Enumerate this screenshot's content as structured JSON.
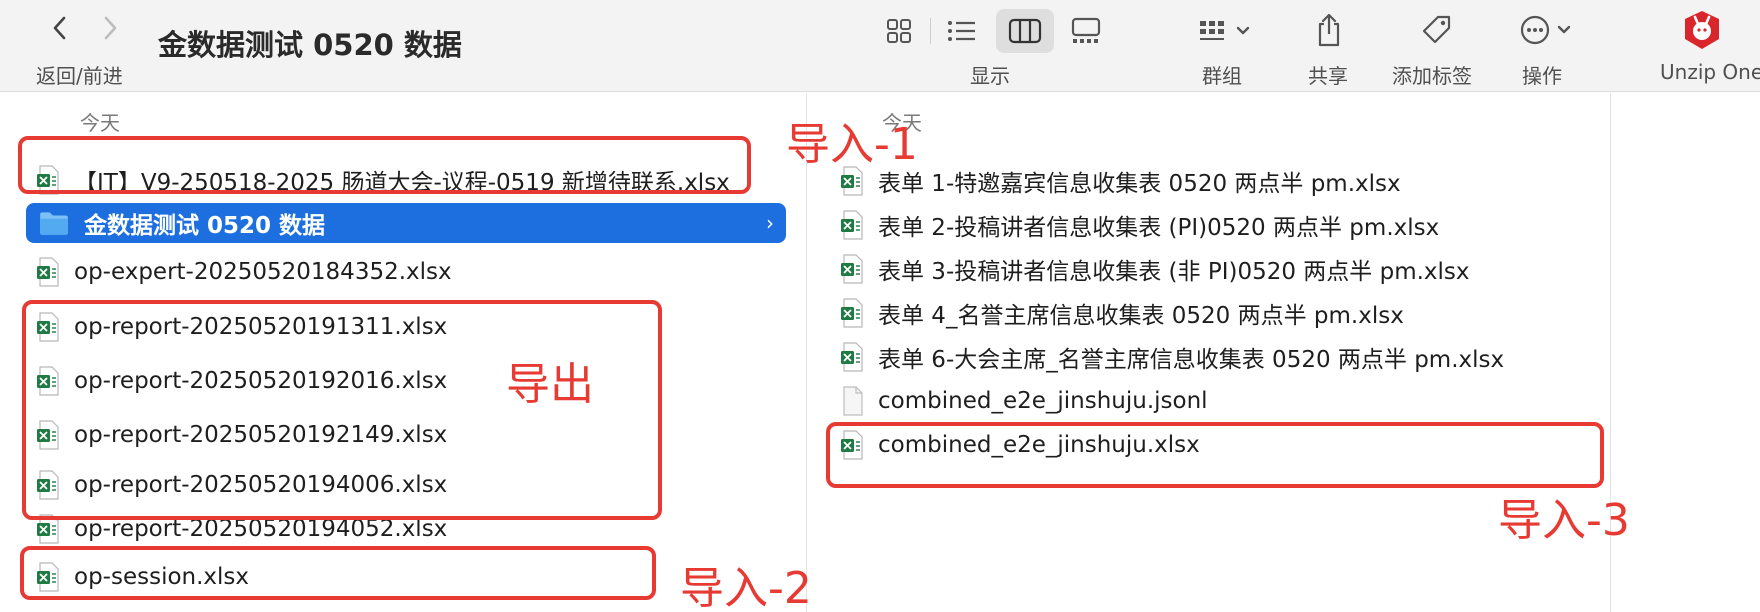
{
  "toolbar": {
    "title": "金数据测试 0520 数据",
    "nav_caption": "返回/前进",
    "back_icon": "chevron-left-icon",
    "forward_icon": "chevron-right-icon",
    "view_label": "显示",
    "group_label": "群组",
    "share_label": "共享",
    "tag_label": "添加标签",
    "action_label": "操作",
    "extension_label": "Unzip One"
  },
  "columns": {
    "left_section": "今天",
    "right_section": "今天"
  },
  "left_items": [
    {
      "name": "【IT】V9-250518-2025 肠道大会-议程-0519 新增待联系.xlsx",
      "kind": "xlsx"
    },
    {
      "name": "金数据测试 0520 数据",
      "kind": "folder",
      "selected": true
    },
    {
      "name": "op-expert-20250520184352.xlsx",
      "kind": "xlsx"
    },
    {
      "name": "op-report-20250520191311.xlsx",
      "kind": "xlsx"
    },
    {
      "name": "op-report-20250520192016.xlsx",
      "kind": "xlsx"
    },
    {
      "name": "op-report-20250520192149.xlsx",
      "kind": "xlsx"
    },
    {
      "name": "op-report-20250520194006.xlsx",
      "kind": "xlsx"
    },
    {
      "name": "op-report-20250520194052.xlsx",
      "kind": "xlsx"
    },
    {
      "name": "op-session.xlsx",
      "kind": "xlsx"
    }
  ],
  "right_items": [
    {
      "name": "表单 1-特邀嘉宾信息收集表 0520 两点半 pm.xlsx",
      "kind": "xlsx"
    },
    {
      "name": "表单 2-投稿讲者信息收集表 (PI)0520 两点半 pm.xlsx",
      "kind": "xlsx"
    },
    {
      "name": "表单 3-投稿讲者信息收集表 (非 PI)0520 两点半 pm.xlsx",
      "kind": "xlsx"
    },
    {
      "name": "表单 4_名誉主席信息收集表 0520 两点半 pm.xlsx",
      "kind": "xlsx"
    },
    {
      "name": "表单 6-大会主席_名誉主席信息收集表 0520 两点半 pm.xlsx",
      "kind": "xlsx"
    },
    {
      "name": "combined_e2e_jinshuju.jsonl",
      "kind": "document"
    },
    {
      "name": "combined_e2e_jinshuju.xlsx",
      "kind": "xlsx"
    }
  ],
  "annotations": {
    "import1": "导入-1",
    "export": "导出",
    "import2": "导入-2",
    "import3": "导入-3",
    "color": "#e63a33"
  },
  "colors": {
    "selection": "#1d6fe0",
    "excel_green": "#1f7a43",
    "toolbar_bg": "#f4f3f3",
    "unzip_red": "#d9262c"
  }
}
